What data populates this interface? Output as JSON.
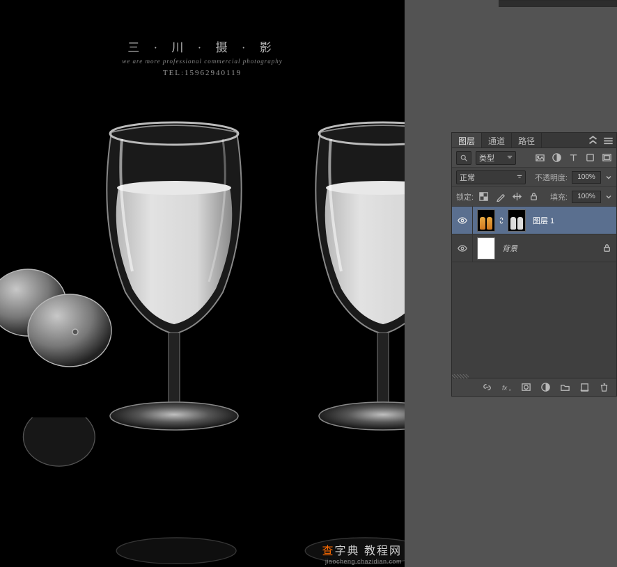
{
  "canvas": {
    "watermark": {
      "line1": "三 · 川 · 摄 · 影",
      "line2": "we are more professional commercial photography",
      "line3": "TEL:15962940119"
    },
    "site_watermark": {
      "brand_part1": "查",
      "brand_part2": "字典",
      "brand_suffix": "教程网",
      "domain": "jiaocheng.chazidian.com"
    }
  },
  "layers_panel": {
    "tabs": {
      "layers": "图层",
      "channels": "通道",
      "paths": "路径"
    },
    "active_tab": "layers",
    "filter_kind_label": "类型",
    "blend_mode": "正常",
    "opacity_label": "不透明度:",
    "opacity_value": "100%",
    "lock_label": "锁定:",
    "fill_label": "填充:",
    "fill_value": "100%",
    "layers": [
      {
        "name": "图层 1",
        "visible": true,
        "selected": true,
        "has_mask": true,
        "locked": false
      },
      {
        "name": "背景",
        "visible": true,
        "selected": false,
        "has_mask": false,
        "locked": true
      }
    ]
  }
}
